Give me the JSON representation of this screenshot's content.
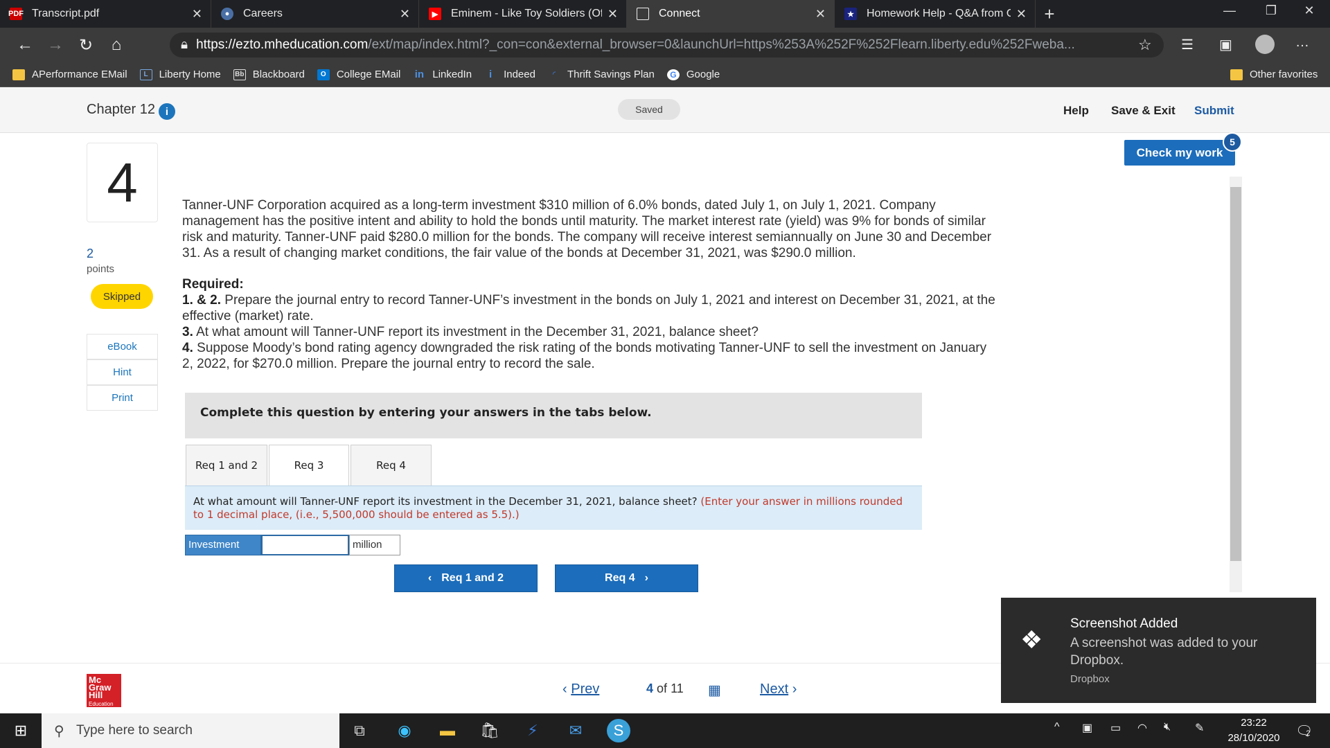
{
  "browser": {
    "tabs": [
      {
        "title": "Transcript.pdf",
        "icon": "pdf-icon"
      },
      {
        "title": "Careers",
        "icon": "seal-icon"
      },
      {
        "title": "Eminem - Like Toy Soldiers (Offic",
        "icon": "youtube-icon"
      },
      {
        "title": "Connect",
        "icon": "page-icon"
      },
      {
        "title": "Homework Help - Q&A from On",
        "icon": "star-icon"
      }
    ],
    "url_host": "https://ezto.mheducation.com",
    "url_rest": "/ext/map/index.html?_con=con&external_browser=0&launchUrl=https%253A%252F%252Flearn.liberty.edu%252Fweba...",
    "bookmarks": [
      {
        "label": "APerformance EMail"
      },
      {
        "label": "Liberty Home"
      },
      {
        "label": "Blackboard"
      },
      {
        "label": "College EMail"
      },
      {
        "label": "LinkedIn"
      },
      {
        "label": "Indeed"
      },
      {
        "label": "Thrift Savings Plan"
      },
      {
        "label": "Google"
      }
    ],
    "other_favorites": "Other favorites"
  },
  "header": {
    "chapter": "Chapter 12",
    "saved": "Saved",
    "help": "Help",
    "save_exit": "Save & Exit",
    "submit": "Submit"
  },
  "question": {
    "number": "4",
    "points": "2",
    "points_label": "points",
    "status": "Skipped",
    "side_links": [
      "eBook",
      "Hint",
      "Print"
    ],
    "body": "Tanner-UNF Corporation acquired as a long-term investment $310 million of 6.0% bonds, dated July 1, on July 1, 2021. Company management has the positive intent and ability to hold the bonds until maturity. The market interest rate (yield) was 9% for bonds of similar risk and maturity. Tanner-UNF paid $280.0 million for the bonds. The company will receive interest semiannually on June 30 and December 31. As a result of changing market conditions, the fair value of the bonds at December 31, 2021, was $290.0 million.",
    "required_label": "Required:",
    "req12_num": "1. & 2.",
    "req12": "Prepare the journal entry to record Tanner-UNF’s investment in the bonds on July 1, 2021 and interest on December 31, 2021, at the effective (market) rate.",
    "req3_num": "3.",
    "req3": "At what amount will Tanner-UNF report its investment in the December 31, 2021, balance sheet?",
    "req4_num": "4.",
    "req4": "Suppose Moody’s bond rating agency downgraded the risk rating of the bonds motivating Tanner-UNF to sell the investment on January 2, 2022, for $270.0 million. Prepare the journal entry to record the sale."
  },
  "work": {
    "instruction": "Complete this question by entering your answers in the tabs below.",
    "tabs": [
      "Req 1 and 2",
      "Req 3",
      "Req 4"
    ],
    "prompt": "At what amount will Tanner-UNF report its investment in the December 31, 2021, balance sheet?",
    "prompt_note": "(Enter your answer in millions rounded to 1 decimal place, (i.e., 5,500,000 should be entered as 5.5).)",
    "investment_label": "Investment",
    "investment_value": "",
    "unit": "million",
    "prev_btn": "Req 1 and 2",
    "next_btn": "Req 4"
  },
  "check": {
    "label": "Check my work",
    "badge": "5"
  },
  "pager": {
    "prev": "Prev",
    "current": "4",
    "of": "of",
    "total": "11",
    "next": "Next"
  },
  "logo": {
    "l1": "Mc",
    "l2": "Graw",
    "l3": "Hill",
    "l4": "Education"
  },
  "toast": {
    "title": "Screenshot Added",
    "message": "A screenshot was added to your Dropbox.",
    "source": "Dropbox"
  },
  "taskbar": {
    "search_placeholder": "Type here to search",
    "time": "23:22",
    "date": "28/10/2020",
    "notif_count": "2"
  }
}
